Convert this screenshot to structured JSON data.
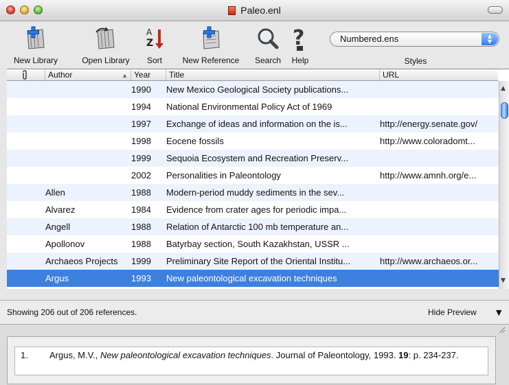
{
  "window": {
    "title": "Paleo.enl"
  },
  "toolbar": {
    "items": [
      {
        "label": "New Library",
        "icon": "new-library-icon"
      },
      {
        "label": "Open Library",
        "icon": "open-library-icon"
      },
      {
        "label": "Sort",
        "icon": "sort-az-icon"
      },
      {
        "label": "New Reference",
        "icon": "new-reference-icon"
      },
      {
        "label": "Search",
        "icon": "magnifier-icon"
      },
      {
        "label": "Help",
        "icon": "help-icon"
      }
    ],
    "styles_value": "Numbered.ens",
    "styles_label": "Styles"
  },
  "table": {
    "columns": {
      "attachment": "",
      "author": "Author",
      "year": "Year",
      "title": "Title",
      "url": "URL"
    },
    "rows": [
      {
        "author": "",
        "year": "1990",
        "title": "New Mexico Geological Society publications...",
        "url": ""
      },
      {
        "author": "",
        "year": "1994",
        "title": "National Environmental Policy Act of 1969",
        "url": ""
      },
      {
        "author": "",
        "year": "1997",
        "title": "Exchange of ideas and information on the is...",
        "url": "http://energy.senate.gov/"
      },
      {
        "author": "",
        "year": "1998",
        "title": "Eocene fossils",
        "url": "http://www.coloradomt..."
      },
      {
        "author": "",
        "year": "1999",
        "title": "Sequoia Ecosystem and Recreation Preserv...",
        "url": ""
      },
      {
        "author": "",
        "year": "2002",
        "title": "Personalities in Paleontology",
        "url": "http://www.amnh.org/e..."
      },
      {
        "author": "Allen",
        "year": "1988",
        "title": "Modern-period muddy sediments in the sev...",
        "url": ""
      },
      {
        "author": "Alvarez",
        "year": "1984",
        "title": "Evidence from crater ages for periodic impa...",
        "url": ""
      },
      {
        "author": "Angell",
        "year": "1988",
        "title": "Relation of Antarctic 100 mb temperature an...",
        "url": ""
      },
      {
        "author": "Apollonov",
        "year": "1988",
        "title": "Batyrbay section, South Kazakhstan, USSR ...",
        "url": ""
      },
      {
        "author": "Archaeos Projects",
        "year": "1999",
        "title": "Preliminary Site Report of the Oriental Institu...",
        "url": "http://www.archaeos.or..."
      },
      {
        "author": "Argus",
        "year": "1993",
        "title": "New paleontological excavation techniques",
        "url": "",
        "selected": true
      }
    ]
  },
  "status": {
    "count_text": "Showing 206 out of 206 references.",
    "hide_preview": "Hide Preview"
  },
  "preview": {
    "number": "1.",
    "author": "Argus, M.V., ",
    "title": "New paleontological excavation techniques",
    "journal": ". Journal of Paleontology, 1993. ",
    "volume": "19",
    "pages": ": p. 234-237."
  },
  "colors": {
    "selection": "#3d80df",
    "stripe": "#edf3fe"
  }
}
